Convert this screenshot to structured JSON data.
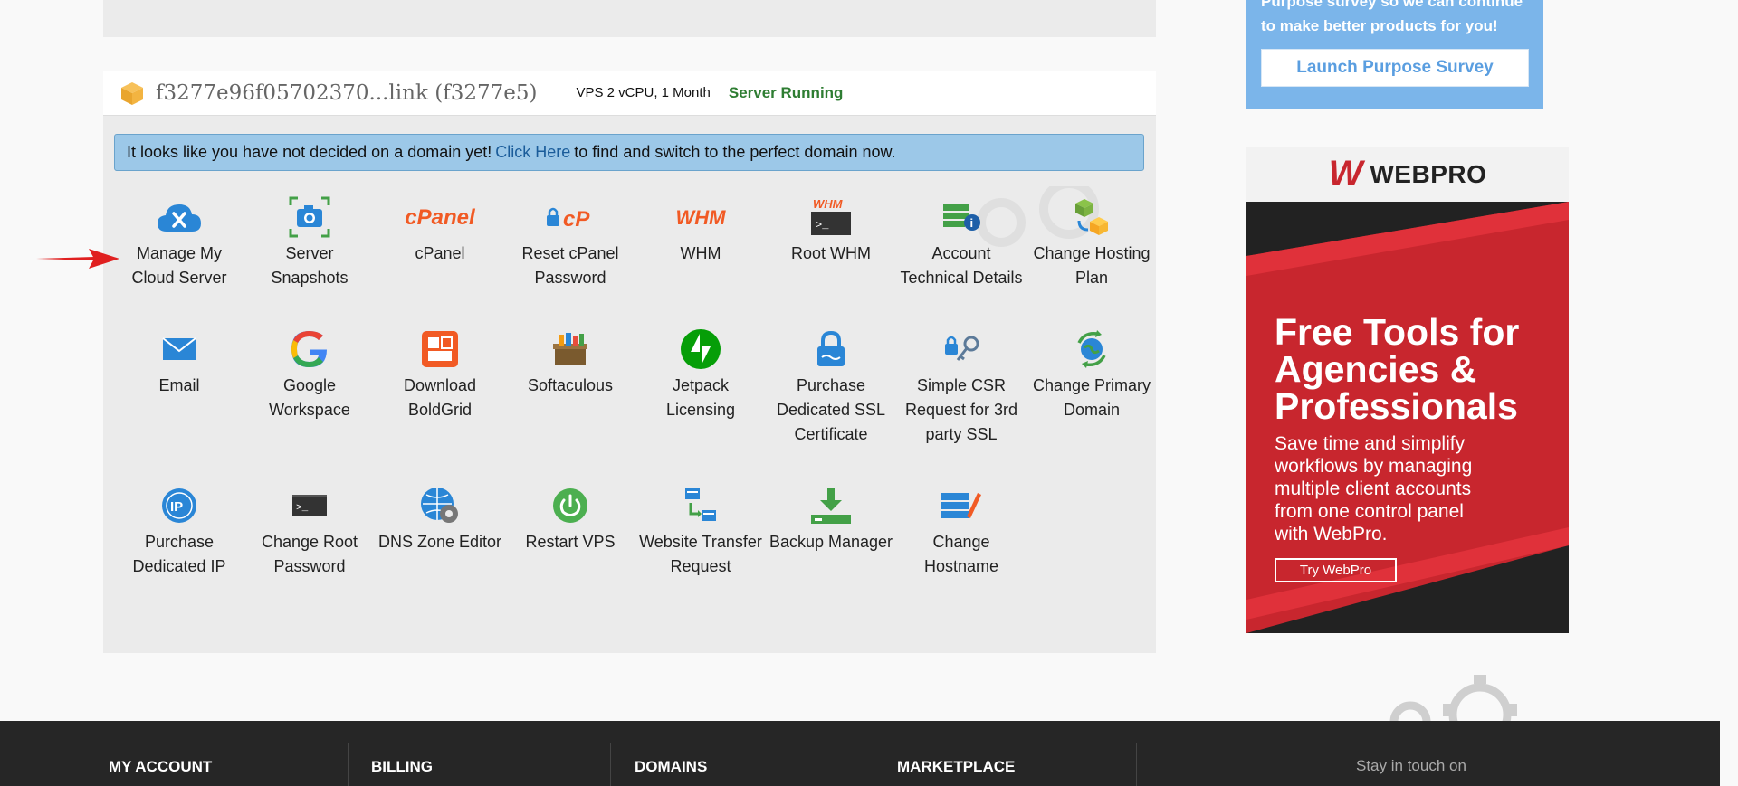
{
  "server": {
    "name": "f3277e96f05702370...link (f3277e5)",
    "plan": "VPS 2 vCPU, 1 Month",
    "status": "Server Running"
  },
  "alert": {
    "prefix": "It looks like you have not decided on a domain yet!",
    "link": "Click Here",
    "suffix": "to find and switch to the perfect domain now."
  },
  "tiles": [
    {
      "label": "Manage My Cloud Server",
      "icon": "cloud-wrench-icon"
    },
    {
      "label": "Server Snapshots",
      "icon": "camera-icon"
    },
    {
      "label": "cPanel",
      "icon": "cpanel-icon"
    },
    {
      "label": "Reset cPanel Password",
      "icon": "lock-cpanel-icon"
    },
    {
      "label": "WHM",
      "icon": "whm-icon"
    },
    {
      "label": "Root WHM",
      "icon": "root-whm-terminal-icon"
    },
    {
      "label": "Account Technical Details",
      "icon": "server-info-icon"
    },
    {
      "label": "Change Hosting Plan",
      "icon": "change-plan-icon"
    },
    {
      "label": "Email",
      "icon": "envelope-icon"
    },
    {
      "label": "Google Workspace",
      "icon": "google-icon"
    },
    {
      "label": "Download BoldGrid",
      "icon": "boldgrid-icon"
    },
    {
      "label": "Softaculous",
      "icon": "softaculous-icon"
    },
    {
      "label": "Jetpack Licensing",
      "icon": "jetpack-icon"
    },
    {
      "label": "Purchase Dedicated SSL Certificate",
      "icon": "ssl-lock-icon"
    },
    {
      "label": "Simple CSR Request for 3rd party SSL",
      "icon": "key-icon"
    },
    {
      "label": "Change Primary Domain",
      "icon": "globe-refresh-icon"
    },
    {
      "label": "Purchase Dedicated IP",
      "icon": "ip-icon"
    },
    {
      "label": "Change Root Password",
      "icon": "terminal-icon"
    },
    {
      "label": "DNS Zone Editor",
      "icon": "dns-globe-gear-icon"
    },
    {
      "label": "Restart VPS",
      "icon": "power-icon"
    },
    {
      "label": "Website Transfer Request",
      "icon": "transfer-icon"
    },
    {
      "label": "Backup Manager",
      "icon": "download-backup-icon"
    },
    {
      "label": "Change Hostname",
      "icon": "hostname-edit-icon"
    }
  ],
  "survey": {
    "text_line1": "Purpose survey so we can continue",
    "text_line2": "to make better products for you!",
    "button": "Launch Purpose Survey"
  },
  "ad": {
    "brand_w": "W",
    "brand_text": "WEBPRO",
    "title_line1": "Free Tools for",
    "title_line2": "Agencies &",
    "title_line3": "Professionals",
    "desc_line1": "Save time and simplify",
    "desc_line2": "workflows by managing",
    "desc_line3": "multiple client accounts",
    "desc_line4": "from one control panel",
    "desc_line5": "with WebPro.",
    "button": "Try WebPro"
  },
  "footer": {
    "col1": "MY ACCOUNT",
    "col2": "BILLING",
    "col3": "DOMAINS",
    "col4": "MARKETPLACE",
    "stay": "Stay in touch on"
  },
  "colors": {
    "accent_blue": "#2a86d6",
    "status_green": "#2e7d32",
    "ad_red": "#c8262e",
    "footer_bg": "#262626"
  }
}
